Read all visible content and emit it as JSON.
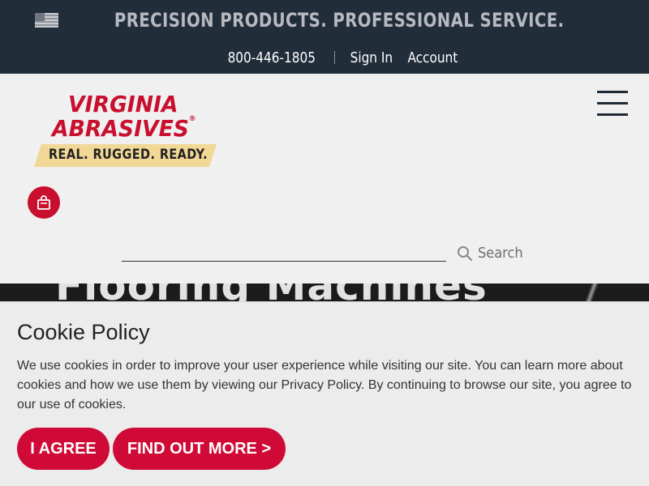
{
  "topbar": {
    "tagline": "PRECISION PRODUCTS. PROFESSIONAL SERVICE.",
    "phone": "800-446-1805",
    "sign_in": "Sign In",
    "account": "Account"
  },
  "logo": {
    "line1": "VIRGINIA",
    "line2": "ABRASIVES",
    "registered": "®",
    "slogan": "REAL. RUGGED. READY."
  },
  "search": {
    "placeholder": "",
    "button_label": "Search"
  },
  "hero": {
    "heading": "Flooring Machines"
  },
  "cookie": {
    "title": "Cookie Policy",
    "body": "We use cookies in order to improve your user experience while visiting our site. You can learn more about cookies and how we use them by viewing our Privacy Policy. By continuing to browse our site, you agree to our use of cookies.",
    "agree_label": "I AGREE",
    "more_label": "FIND OUT MORE >"
  },
  "colors": {
    "topbar_bg": "#222d3a",
    "brand_red": "#c8102e",
    "button_red": "#cf0a36",
    "slogan_band": "#f1d896"
  },
  "icons": [
    "us-flag-icon",
    "menu-icon",
    "shopping-bag-icon",
    "search-icon"
  ]
}
